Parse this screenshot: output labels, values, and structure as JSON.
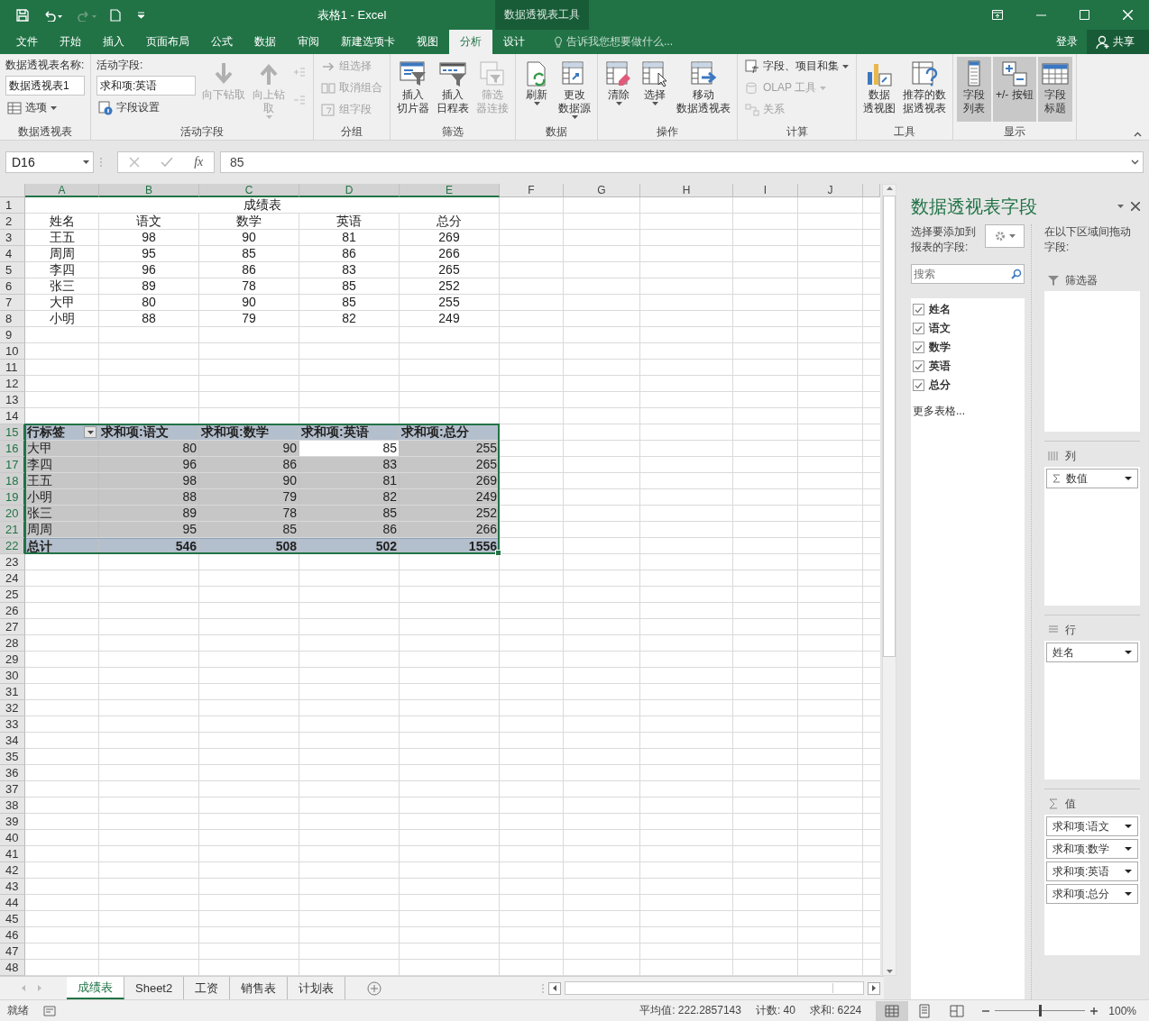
{
  "title_bar": {
    "title": "表格1 - Excel",
    "context_tab": "数据透视表工具"
  },
  "menu_tabs": [
    {
      "label": "文件",
      "selected": false
    },
    {
      "label": "开始",
      "selected": false
    },
    {
      "label": "插入",
      "selected": false
    },
    {
      "label": "页面布局",
      "selected": false
    },
    {
      "label": "公式",
      "selected": false
    },
    {
      "label": "数据",
      "selected": false
    },
    {
      "label": "审阅",
      "selected": false
    },
    {
      "label": "新建选项卡",
      "selected": false
    },
    {
      "label": "视图",
      "selected": false
    },
    {
      "label": "分析",
      "selected": true
    },
    {
      "label": "设计",
      "selected": false
    }
  ],
  "tell_me": {
    "placeholder": "告诉我您想要做什么..."
  },
  "account": {
    "sign_in": "登录",
    "share": "共享"
  },
  "ribbon": [
    {
      "name": "数据透视表",
      "items": [
        {
          "kind": "stack",
          "entries": [
            {
              "kind": "caption",
              "label": "数据透视表名称:"
            },
            {
              "kind": "input",
              "value": "数据透视表1"
            },
            {
              "kind": "small",
              "label": "选项",
              "disabled": false,
              "dropdown": true
            }
          ]
        }
      ]
    },
    {
      "name": "活动字段",
      "items": [
        {
          "kind": "stack",
          "entries": [
            {
              "kind": "caption",
              "label": "活动字段:"
            },
            {
              "kind": "input",
              "value": "求和项:英语"
            },
            {
              "kind": "small",
              "label": "字段设置",
              "disabled": false,
              "dropdown": false
            }
          ]
        },
        {
          "kind": "large",
          "lines": [
            "向下钻取"
          ],
          "disabled": true,
          "dropdown": false
        },
        {
          "kind": "large",
          "lines": [
            "向上钻",
            "取"
          ],
          "disabled": true,
          "dropdown": true
        },
        {
          "kind": "expand_collapse",
          "disabled": true
        }
      ]
    },
    {
      "name": "分组",
      "items": [
        {
          "kind": "stack",
          "entries": [
            {
              "kind": "small",
              "label": "组选择",
              "disabled": true,
              "dropdown": false
            },
            {
              "kind": "small",
              "label": "取消组合",
              "disabled": true,
              "dropdown": false
            },
            {
              "kind": "small",
              "label": "组字段",
              "disabled": true,
              "dropdown": false
            }
          ]
        }
      ]
    },
    {
      "name": "筛选",
      "items": [
        {
          "kind": "large",
          "lines": [
            "插入",
            "切片器"
          ],
          "disabled": false,
          "dropdown": false
        },
        {
          "kind": "large",
          "lines": [
            "插入",
            "日程表"
          ],
          "disabled": false,
          "dropdown": false
        },
        {
          "kind": "large",
          "lines": [
            "筛选",
            "器连接"
          ],
          "disabled": true,
          "dropdown": false
        }
      ]
    },
    {
      "name": "数据",
      "items": [
        {
          "kind": "large",
          "lines": [
            "刷新"
          ],
          "disabled": false,
          "dropdown": true
        },
        {
          "kind": "large",
          "lines": [
            "更改",
            "数据源"
          ],
          "disabled": false,
          "dropdown": true
        }
      ]
    },
    {
      "name": "操作",
      "items": [
        {
          "kind": "large",
          "lines": [
            "清除"
          ],
          "disabled": false,
          "dropdown": true
        },
        {
          "kind": "large",
          "lines": [
            "选择"
          ],
          "disabled": false,
          "dropdown": true
        },
        {
          "kind": "large",
          "lines": [
            "移动",
            "数据透视表"
          ],
          "disabled": false,
          "dropdown": false
        }
      ]
    },
    {
      "name": "计算",
      "items": [
        {
          "kind": "stack",
          "entries": [
            {
              "kind": "small",
              "label": "字段、项目和集",
              "disabled": false,
              "dropdown": true
            },
            {
              "kind": "small",
              "label": "OLAP 工具",
              "disabled": true,
              "dropdown": true
            },
            {
              "kind": "small",
              "label": "关系",
              "disabled": true,
              "dropdown": false
            }
          ]
        }
      ]
    },
    {
      "name": "工具",
      "items": [
        {
          "kind": "large",
          "lines": [
            "数据",
            "透视图"
          ],
          "disabled": false,
          "dropdown": false
        },
        {
          "kind": "large",
          "lines": [
            "推荐的数",
            "据透视表"
          ],
          "disabled": false,
          "dropdown": false
        }
      ]
    },
    {
      "name": "显示",
      "items": [
        {
          "kind": "large",
          "lines": [
            "字段",
            "列表"
          ],
          "disabled": false,
          "dropdown": false,
          "selected": true
        },
        {
          "kind": "large",
          "lines": [
            "+/- 按钮"
          ],
          "disabled": false,
          "dropdown": false,
          "selected": true
        },
        {
          "kind": "large",
          "lines": [
            "字段",
            "标题"
          ],
          "disabled": false,
          "dropdown": false,
          "selected": true
        }
      ]
    }
  ],
  "formula_bar": {
    "name_box": "D16",
    "function_label": "fx",
    "value": "85"
  },
  "sheet": {
    "columns": [
      {
        "letter": "A",
        "selected": true
      },
      {
        "letter": "B",
        "selected": true
      },
      {
        "letter": "C",
        "selected": true
      },
      {
        "letter": "D",
        "selected": true
      },
      {
        "letter": "E",
        "selected": true
      },
      {
        "letter": "F",
        "selected": false
      },
      {
        "letter": "G",
        "selected": false
      },
      {
        "letter": "H",
        "selected": false
      },
      {
        "letter": "I",
        "selected": false
      },
      {
        "letter": "J",
        "selected": false
      }
    ],
    "rows": [
      {
        "number": "1",
        "selected": false,
        "kind": "title",
        "cells": [
          "成绩表"
        ]
      },
      {
        "number": "2",
        "selected": false,
        "kind": "header",
        "cells": [
          "姓名",
          "语文",
          "数学",
          "英语",
          "总分"
        ]
      },
      {
        "number": "3",
        "selected": false,
        "kind": "data",
        "cells": [
          "王五",
          "98",
          "90",
          "81",
          "269"
        ]
      },
      {
        "number": "4",
        "selected": false,
        "kind": "data",
        "cells": [
          "周周",
          "95",
          "85",
          "86",
          "266"
        ]
      },
      {
        "number": "5",
        "selected": false,
        "kind": "data",
        "cells": [
          "李四",
          "96",
          "86",
          "83",
          "265"
        ]
      },
      {
        "number": "6",
        "selected": false,
        "kind": "data",
        "cells": [
          "张三",
          "89",
          "78",
          "85",
          "252"
        ]
      },
      {
        "number": "7",
        "selected": false,
        "kind": "data",
        "cells": [
          "大甲",
          "80",
          "90",
          "85",
          "255"
        ]
      },
      {
        "number": "8",
        "selected": false,
        "kind": "data",
        "cells": [
          "小明",
          "88",
          "79",
          "82",
          "249"
        ]
      },
      {
        "number": "9",
        "selected": false,
        "kind": "empty"
      },
      {
        "number": "10",
        "selected": false,
        "kind": "empty"
      },
      {
        "number": "11",
        "selected": false,
        "kind": "empty"
      },
      {
        "number": "12",
        "selected": false,
        "kind": "empty"
      },
      {
        "number": "13",
        "selected": false,
        "kind": "empty"
      },
      {
        "number": "14",
        "selected": false,
        "kind": "empty"
      },
      {
        "number": "15",
        "selected": true,
        "kind": "pivot_header",
        "cells": [
          "行标签",
          "求和项:语文",
          "求和项:数学",
          "求和项:英语",
          "求和项:总分"
        ]
      },
      {
        "number": "16",
        "selected": true,
        "kind": "pivot_data",
        "cells": [
          {
            "text": "大甲",
            "selected": false
          },
          {
            "text": "80",
            "selected": false
          },
          {
            "text": "90",
            "selected": false
          },
          {
            "text": "85",
            "selected": true
          },
          {
            "text": "255",
            "selected": false
          }
        ]
      },
      {
        "number": "17",
        "selected": true,
        "kind": "pivot_data",
        "cells": [
          {
            "text": "李四",
            "selected": false
          },
          {
            "text": "96",
            "selected": false
          },
          {
            "text": "86",
            "selected": false
          },
          {
            "text": "83",
            "selected": false
          },
          {
            "text": "265",
            "selected": false
          }
        ]
      },
      {
        "number": "18",
        "selected": true,
        "kind": "pivot_data",
        "cells": [
          {
            "text": "王五",
            "selected": false
          },
          {
            "text": "98",
            "selected": false
          },
          {
            "text": "90",
            "selected": false
          },
          {
            "text": "81",
            "selected": false
          },
          {
            "text": "269",
            "selected": false
          }
        ]
      },
      {
        "number": "19",
        "selected": true,
        "kind": "pivot_data",
        "cells": [
          {
            "text": "小明",
            "selected": false
          },
          {
            "text": "88",
            "selected": false
          },
          {
            "text": "79",
            "selected": false
          },
          {
            "text": "82",
            "selected": false
          },
          {
            "text": "249",
            "selected": false
          }
        ]
      },
      {
        "number": "20",
        "selected": true,
        "kind": "pivot_data",
        "cells": [
          {
            "text": "张三",
            "selected": false
          },
          {
            "text": "89",
            "selected": false
          },
          {
            "text": "78",
            "selected": false
          },
          {
            "text": "85",
            "selected": false
          },
          {
            "text": "252",
            "selected": false
          }
        ]
      },
      {
        "number": "21",
        "selected": true,
        "kind": "pivot_data",
        "cells": [
          {
            "text": "周周",
            "selected": false
          },
          {
            "text": "95",
            "selected": false
          },
          {
            "text": "85",
            "selected": false
          },
          {
            "text": "86",
            "selected": false
          },
          {
            "text": "266",
            "selected": false
          }
        ]
      },
      {
        "number": "22",
        "selected": true,
        "kind": "pivot_total",
        "cells": [
          "总计",
          "546",
          "508",
          "502",
          "1556"
        ]
      },
      {
        "number": "23",
        "selected": false,
        "kind": "empty"
      },
      {
        "number": "24",
        "selected": false,
        "kind": "empty"
      },
      {
        "number": "25",
        "selected": false,
        "kind": "empty"
      },
      {
        "number": "26",
        "selected": false,
        "kind": "empty"
      },
      {
        "number": "27",
        "selected": false,
        "kind": "empty"
      },
      {
        "number": "28",
        "selected": false,
        "kind": "empty"
      },
      {
        "number": "29",
        "selected": false,
        "kind": "empty"
      },
      {
        "number": "30",
        "selected": false,
        "kind": "empty"
      },
      {
        "number": "31",
        "selected": false,
        "kind": "empty"
      },
      {
        "number": "32",
        "selected": false,
        "kind": "empty"
      },
      {
        "number": "33",
        "selected": false,
        "kind": "empty"
      },
      {
        "number": "34",
        "selected": false,
        "kind": "empty"
      },
      {
        "number": "35",
        "selected": false,
        "kind": "empty"
      },
      {
        "number": "36",
        "selected": false,
        "kind": "empty"
      },
      {
        "number": "37",
        "selected": false,
        "kind": "empty"
      },
      {
        "number": "38",
        "selected": false,
        "kind": "empty"
      },
      {
        "number": "39",
        "selected": false,
        "kind": "empty"
      },
      {
        "number": "40",
        "selected": false,
        "kind": "empty"
      },
      {
        "number": "41",
        "selected": false,
        "kind": "empty"
      },
      {
        "number": "42",
        "selected": false,
        "kind": "empty"
      },
      {
        "number": "43",
        "selected": false,
        "kind": "empty"
      },
      {
        "number": "44",
        "selected": false,
        "kind": "empty"
      },
      {
        "number": "45",
        "selected": false,
        "kind": "empty"
      },
      {
        "number": "46",
        "selected": false,
        "kind": "empty"
      },
      {
        "number": "47",
        "selected": false,
        "kind": "empty"
      },
      {
        "number": "48",
        "selected": false,
        "kind": "empty"
      }
    ]
  },
  "sheet_tabs": [
    {
      "label": "成绩表",
      "selected": true
    },
    {
      "label": "Sheet2",
      "selected": false
    },
    {
      "label": "工资",
      "selected": false
    },
    {
      "label": "销售表",
      "selected": false
    },
    {
      "label": "计划表",
      "selected": false
    }
  ],
  "field_pane": {
    "title": "数据透视表字段",
    "choose_label": "选择要添加到报表的字段:",
    "search": {
      "placeholder": "搜索"
    },
    "fields": [
      {
        "label": "姓名",
        "checked": true
      },
      {
        "label": "语文",
        "checked": true
      },
      {
        "label": "数学",
        "checked": true
      },
      {
        "label": "英语",
        "checked": true
      },
      {
        "label": "总分",
        "checked": true
      }
    ],
    "more_tables": "更多表格...",
    "drag_hint": "在以下区域间拖动字段:",
    "areas": [
      {
        "kind": "filters",
        "title": "筛选器"
      },
      {
        "kind": "columns",
        "title": "列",
        "items": [
          {
            "label": "数值",
            "kind": "values_placeholder"
          }
        ]
      },
      {
        "kind": "rows",
        "title": "行",
        "items": [
          {
            "label": "姓名",
            "kind": "field"
          }
        ]
      },
      {
        "kind": "values",
        "title": "值",
        "items": [
          {
            "label": "求和项:语文",
            "kind": "field"
          },
          {
            "label": "求和项:数学",
            "kind": "field"
          },
          {
            "label": "求和项:英语",
            "kind": "field"
          },
          {
            "label": "求和项:总分",
            "kind": "field"
          }
        ]
      }
    ]
  },
  "status_bar": {
    "ready": "就绪",
    "average": "平均值: 222.2857143",
    "count": "计数: 40",
    "sum": "求和: 6224",
    "views": [
      {
        "kind": "normal",
        "selected": true
      },
      {
        "kind": "page_layout",
        "selected": false
      },
      {
        "kind": "page_break",
        "selected": false
      }
    ],
    "zoom": {
      "label": "100%",
      "level": 0.5
    }
  }
}
